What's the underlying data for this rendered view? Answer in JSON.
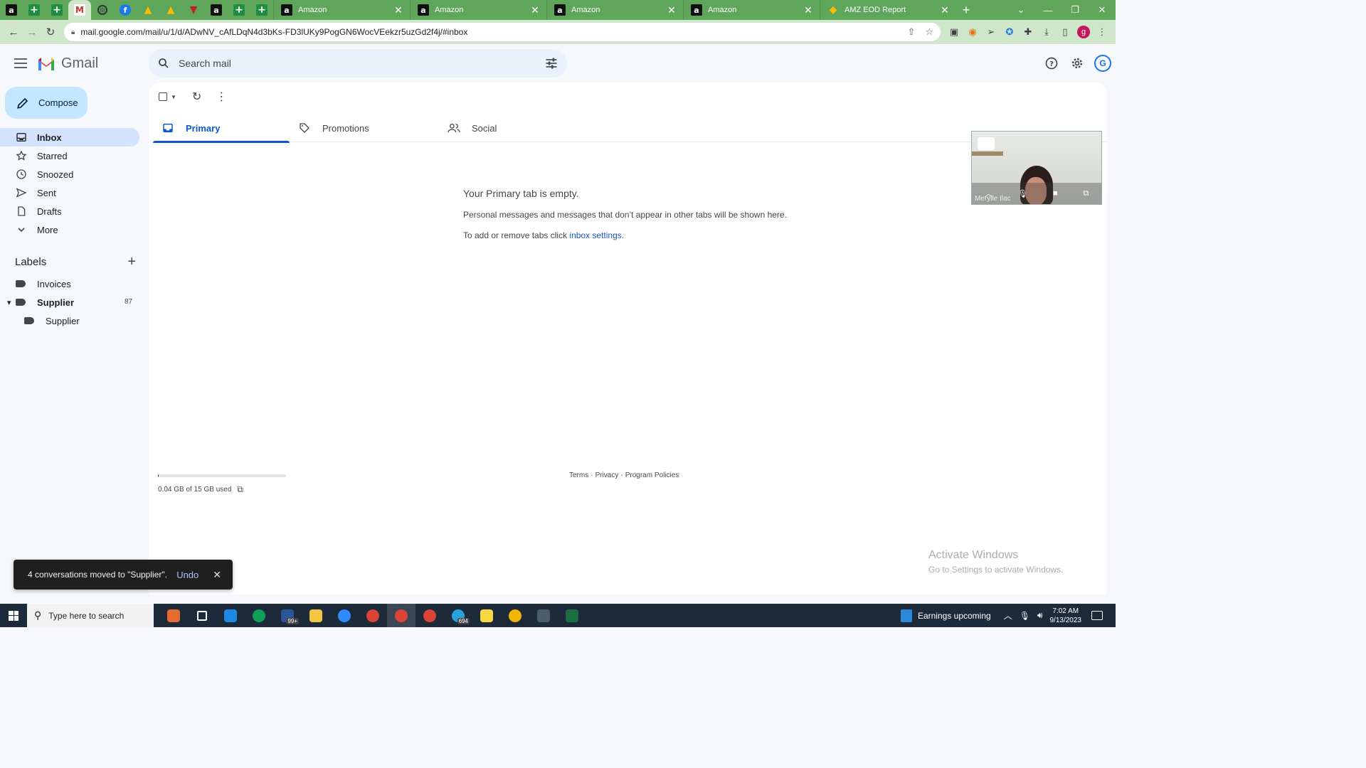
{
  "browser": {
    "pinned_tabs": [
      {
        "icon": "amazon-icon",
        "glyph": "a"
      },
      {
        "icon": "sheets-plus-icon",
        "glyph": "+"
      },
      {
        "icon": "sheets-plus-icon",
        "glyph": "+"
      },
      {
        "icon": "gmail-icon",
        "glyph": "M"
      },
      {
        "icon": "globe-icon",
        "glyph": "◎"
      },
      {
        "icon": "facebook-icon",
        "glyph": "f"
      },
      {
        "icon": "drive-icon",
        "glyph": "▲"
      },
      {
        "icon": "drive-icon",
        "glyph": "▲"
      },
      {
        "icon": "red-tool-icon",
        "glyph": "▼"
      },
      {
        "icon": "amazon-icon",
        "glyph": "a"
      },
      {
        "icon": "sheets-plus-icon",
        "glyph": "+"
      },
      {
        "icon": "sheets-plus-icon",
        "glyph": "+"
      }
    ],
    "tabs": [
      {
        "title": "Amazon",
        "icon": "amazon-icon"
      },
      {
        "title": "Amazon",
        "icon": "amazon-icon"
      },
      {
        "title": "Amazon",
        "icon": "amazon-icon"
      },
      {
        "title": "Amazon",
        "icon": "amazon-icon"
      },
      {
        "title": "AMZ EOD Report",
        "icon": "report-icon"
      }
    ],
    "url": "mail.google.com/mail/u/1/d/ADwNV_cAfLDqN4d3bKs-FD3lUKy9PogGN6WocVEekzr5uzGd2f4j/#inbox",
    "profile_initial": "g"
  },
  "gmail": {
    "brand": "Gmail",
    "search_placeholder": "Search mail",
    "account_initial": "G",
    "compose_label": "Compose",
    "nav": [
      {
        "label": "Inbox",
        "icon": "inbox-icon",
        "active": true
      },
      {
        "label": "Starred",
        "icon": "star-icon"
      },
      {
        "label": "Snoozed",
        "icon": "clock-icon"
      },
      {
        "label": "Sent",
        "icon": "send-icon"
      },
      {
        "label": "Drafts",
        "icon": "draft-icon"
      },
      {
        "label": "More",
        "icon": "chevron-down-icon"
      }
    ],
    "labels_title": "Labels",
    "labels": [
      {
        "name": "Invoices"
      },
      {
        "name": "Supplier",
        "count": "87",
        "bold": true
      },
      {
        "name": "Supplier",
        "nested": true
      }
    ],
    "tabs": [
      {
        "label": "Primary",
        "icon": "inbox-icon",
        "active": true
      },
      {
        "label": "Promotions",
        "icon": "tag-icon"
      },
      {
        "label": "Social",
        "icon": "people-icon"
      }
    ],
    "empty": {
      "title": "Your Primary tab is empty.",
      "line1": "Personal messages and messages that don’t appear in other tabs will be shown here.",
      "line2_prefix": "To add or remove tabs click ",
      "line2_link": "inbox settings",
      "line2_suffix": "."
    },
    "storage": {
      "text": "0.04 GB of 15 GB used",
      "fraction": 0.003
    },
    "footer": {
      "terms": "Terms",
      "sep": "·",
      "privacy": "Privacy",
      "policies": "Program Policies"
    },
    "pip_name": "Merylle Ilac",
    "snackbar": {
      "message": "4 conversations moved to \"Supplier\".",
      "undo": "Undo"
    }
  },
  "watermark": {
    "line1": "Activate Windows",
    "line2": "Go to Settings to activate Windows."
  },
  "taskbar": {
    "search_placeholder": "Type here to search",
    "apps": [
      {
        "icon": "widgets-icon",
        "color": "#e56b2e"
      },
      {
        "icon": "task-view-icon",
        "color": "#1c2a3a"
      },
      {
        "icon": "store-icon",
        "color": "#1e88e5"
      },
      {
        "icon": "edge-icon",
        "color": "#0f9d58"
      },
      {
        "icon": "mail-icon",
        "color": "#2b579a",
        "badge": "99+"
      },
      {
        "icon": "file-explorer-icon",
        "color": "#f4c542"
      },
      {
        "icon": "zoom-icon",
        "color": "#2d8cff"
      },
      {
        "icon": "chrome-icon",
        "color": "#db4437"
      },
      {
        "icon": "chrome-icon",
        "color": "#db4437",
        "active": true
      },
      {
        "icon": "chrome-icon",
        "color": "#db4437"
      },
      {
        "icon": "telegram-icon",
        "color": "#2aa1da",
        "badge": "694"
      },
      {
        "icon": "sticky-notes-icon",
        "color": "#f7d842"
      },
      {
        "icon": "chrome-icon",
        "color": "#f4b400"
      },
      {
        "icon": "calculator-icon",
        "color": "#4a5b6c"
      },
      {
        "icon": "excel-icon",
        "color": "#1d6f42"
      }
    ],
    "news": "Earnings upcoming",
    "time": "7:02 AM",
    "date": "9/13/2023"
  }
}
